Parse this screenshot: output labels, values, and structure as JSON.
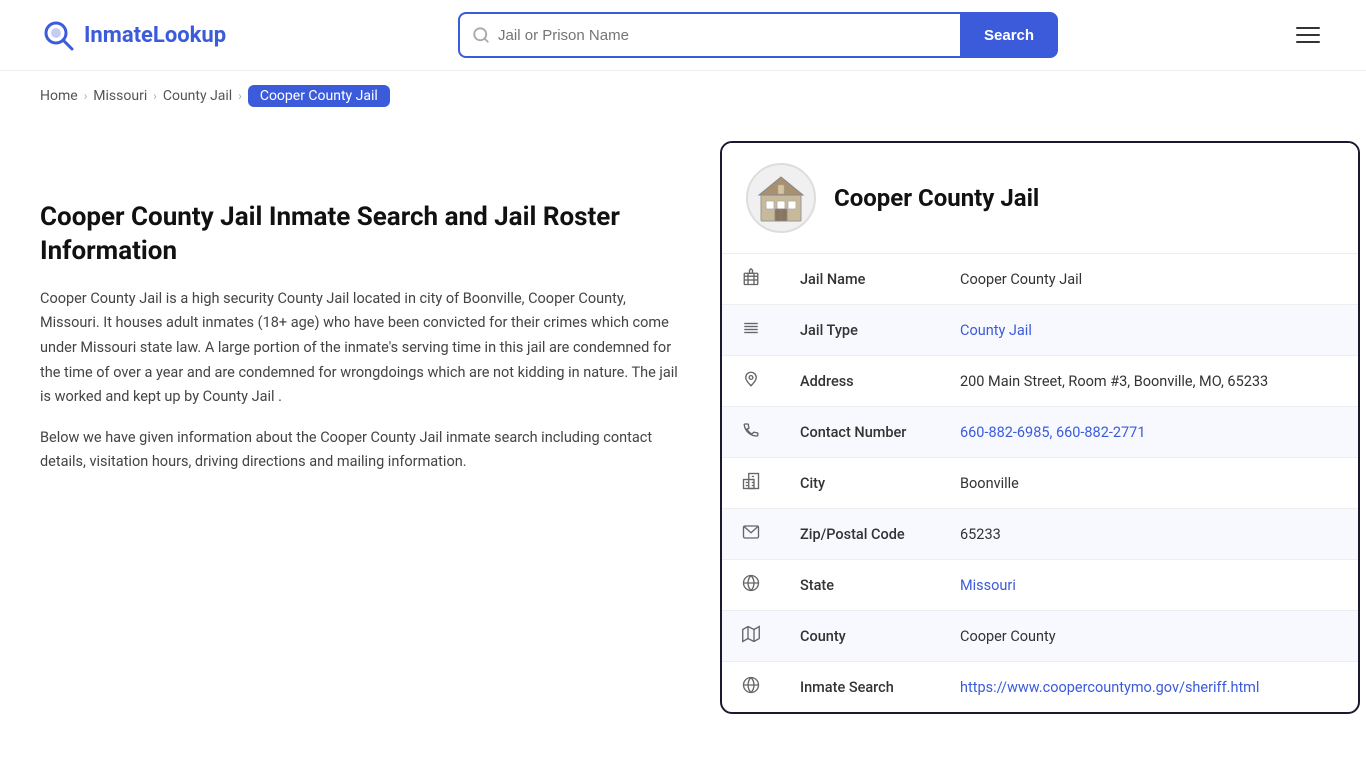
{
  "header": {
    "logo_text": "InmateLookup",
    "search_placeholder": "Jail or Prison Name",
    "search_btn_label": "Search"
  },
  "breadcrumb": {
    "items": [
      {
        "label": "Home",
        "href": "#",
        "active": false
      },
      {
        "label": "Missouri",
        "href": "#",
        "active": false
      },
      {
        "label": "County Jail",
        "href": "#",
        "active": false
      },
      {
        "label": "Cooper County Jail",
        "href": "#",
        "active": true
      }
    ]
  },
  "left": {
    "title": "Cooper County Jail Inmate Search and Jail Roster Information",
    "desc1": "Cooper County Jail is a high security County Jail located in city of Boonville, Cooper County, Missouri. It houses adult inmates (18+ age) who have been convicted for their crimes which come under Missouri state law. A large portion of the inmate's serving time in this jail are condemned for the time of over a year and are condemned for wrongdoings which are not kidding in nature. The jail is worked and kept up by County Jail .",
    "desc2": "Below we have given information about the Cooper County Jail inmate search including contact details, visitation hours, driving directions and mailing information."
  },
  "card": {
    "title": "Cooper County Jail",
    "rows": [
      {
        "icon": "building-icon",
        "label": "Jail Name",
        "value": "Cooper County Jail",
        "link": null
      },
      {
        "icon": "list-icon",
        "label": "Jail Type",
        "value": "County Jail",
        "link": "#"
      },
      {
        "icon": "pin-icon",
        "label": "Address",
        "value": "200 Main Street, Room #3, Boonville, MO, 65233",
        "link": null
      },
      {
        "icon": "phone-icon",
        "label": "Contact Number",
        "value": "660-882-6985, 660-882-2771",
        "link": "#"
      },
      {
        "icon": "city-icon",
        "label": "City",
        "value": "Boonville",
        "link": null
      },
      {
        "icon": "mail-icon",
        "label": "Zip/Postal Code",
        "value": "65233",
        "link": null
      },
      {
        "icon": "globe-icon",
        "label": "State",
        "value": "Missouri",
        "link": "#"
      },
      {
        "icon": "map-icon",
        "label": "County",
        "value": "Cooper County",
        "link": null
      },
      {
        "icon": "search-globe-icon",
        "label": "Inmate Search",
        "value": "https://www.coopercountymo.gov/sheriff.html",
        "link": "https://www.coopercountymo.gov/sheriff.html"
      }
    ]
  }
}
